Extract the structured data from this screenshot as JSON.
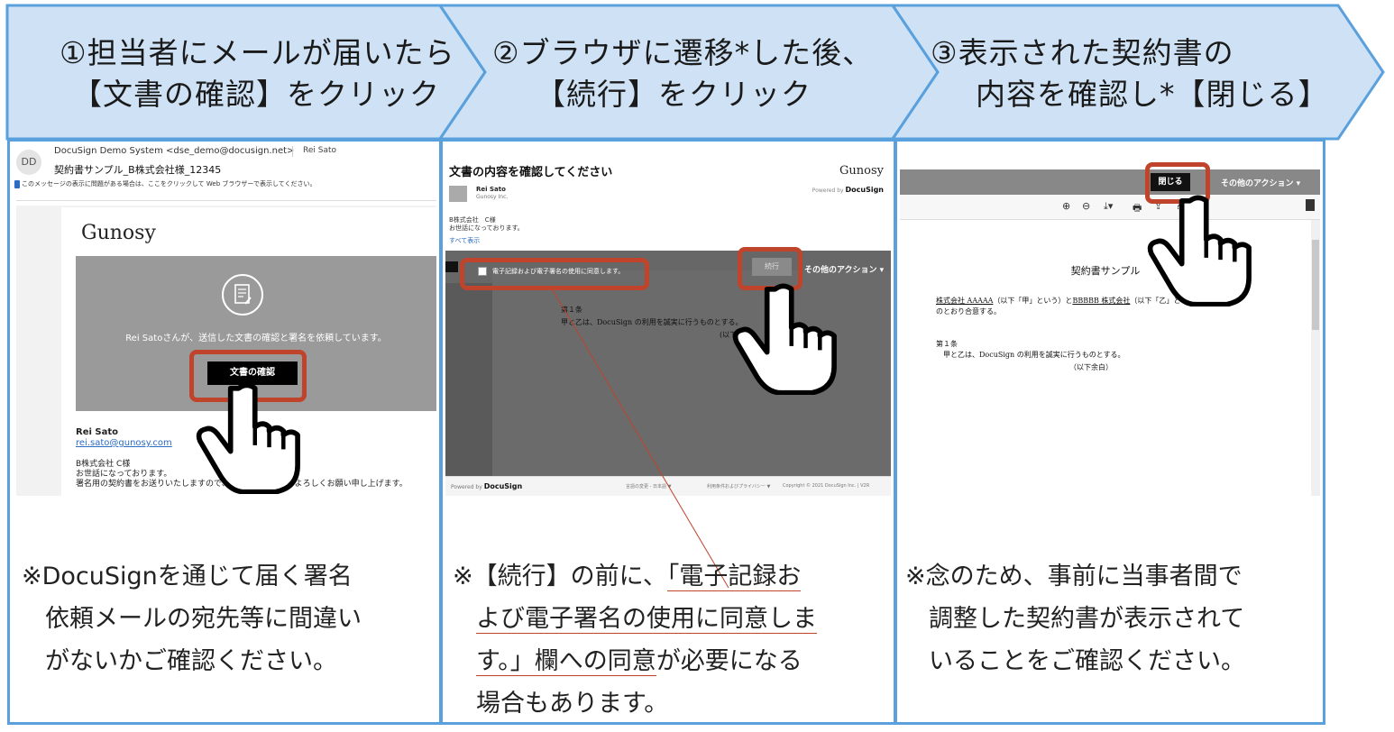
{
  "steps": [
    {
      "line1": "①担当者にメールが届いたら",
      "line2": "【文書の確認】をクリック"
    },
    {
      "line1": "②ブラウザに遷移*した後、",
      "line2": "【続行】をクリック"
    },
    {
      "line1": "③表示された契約書の",
      "line2": "内容を確認し*【閉じる】"
    }
  ],
  "email": {
    "avatar": "DD",
    "sender": "DocuSign Demo System <dse_demo@docusign.net>",
    "recipient": "Rei Sato",
    "subject": "契約書サンプル_B株式会社様_12345",
    "notice": "このメッセージの表示に問題がある場合は、ここをクリックして Web ブラウザーで表示してください。",
    "logo": "Gunosy",
    "request_name": "Rei Sato",
    "request_text": "さんが、送信した文書の確認と署名を依頼しています。",
    "review_button": "文書の確認",
    "sig_name": "Rei Sato",
    "sig_email": "rei.sato@gunosy.com",
    "msg_line1": "B株式会社 C様",
    "msg_line2": "お世話になっております。",
    "msg_line3": "署名用の契約書をお送りいたしますので、ご確認の程宜しくよろしくお願い申し上げます。"
  },
  "docusign": {
    "title": "文書の内容を確認してください",
    "brand": "Gunosy",
    "powered_prefix": "Powered by",
    "powered_brand": "DocuSign",
    "sender_name": "Rei Sato",
    "sender_company": "Gunosy Inc.",
    "msg_line1": "B株式会社　C様",
    "msg_line2": "お世話になっております。",
    "show_all": "すべて表示",
    "agree_label": "電子記録および電子署名の使用に同意します。",
    "continue_button": "続行",
    "other_actions": "その他のアクション ▾",
    "article": "第１条",
    "article_text": "甲と乙は、DocuSign の利用を誠実に行うものとする。",
    "rest": "(以下余白)",
    "foot_lang": "言語の変更 - 日本語 ▼",
    "foot_terms": "利用条件およびプライバシー ▼",
    "foot_copy": "Copyright © 2021 DocuSign Inc. | V2R"
  },
  "viewer": {
    "close_button": "閉じる",
    "other_actions": "その他のアクション ▾",
    "tools": [
      "⊕",
      "⊖",
      "⤓▾",
      "🖶",
      "⇪",
      "?"
    ],
    "doc_title": "契約書サンプル",
    "party_a": "株式会社 AAAAA",
    "mid1": "（以下「甲」という）と",
    "party_b": "BBBBB 株式会社",
    "mid2": "（以下「乙」という）は、以下",
    "line2": "のとおり合意する。",
    "article": "第１条",
    "article_text": "甲と乙は、DocuSign の利用を誠実に行うものとする。",
    "rest": "（以下余白）"
  },
  "notes": {
    "n1": [
      "※DocuSignを通じて届く署名",
      "依頼メールの宛先等に間違い",
      "がないかご確認ください。"
    ],
    "n2_l1a": "※【続行】の前に、",
    "n2_l1b": "「電子記録お",
    "n2_l2": "よび電子署名の使用に同意しま",
    "n2_l3a": "す。」欄への同意",
    "n2_l3b": "が必要になる",
    "n2_l4": "場合もあります。",
    "n3": [
      "※念のため、事前に当事者間で",
      "調整した契約書が表示されて",
      "いることをご確認ください。"
    ]
  },
  "colors": {
    "header_fill": "#cfe2f5",
    "border": "#5aa0dc",
    "highlight": "#c0432b"
  }
}
